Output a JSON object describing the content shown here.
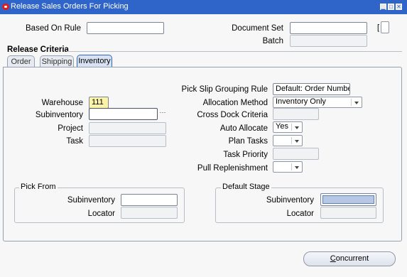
{
  "window": {
    "title": "Release Sales Orders For Picking"
  },
  "header": {
    "based_on_rule": {
      "label": "Based On Rule",
      "value": ""
    },
    "document_set": {
      "label": "Document Set",
      "value": ""
    },
    "batch": {
      "label": "Batch",
      "value": ""
    },
    "flex_field": "[ ]"
  },
  "release_criteria": {
    "title": "Release Criteria",
    "tabs": [
      {
        "label": "Order",
        "active": false
      },
      {
        "label": "Shipping",
        "active": false
      },
      {
        "label": "Inventory",
        "active": true
      }
    ]
  },
  "inventory": {
    "warehouse": {
      "label": "Warehouse",
      "value": "111"
    },
    "subinventory": {
      "label": "Subinventory",
      "value": ""
    },
    "project": {
      "label": "Project",
      "value": ""
    },
    "task": {
      "label": "Task",
      "value": ""
    },
    "pick_slip_grouping_rule": {
      "label": "Pick Slip Grouping Rule",
      "value": "Default: Order Number"
    },
    "allocation_method": {
      "label": "Allocation Method",
      "value": "Inventory Only"
    },
    "cross_dock_criteria": {
      "label": "Cross Dock Criteria",
      "value": ""
    },
    "auto_allocate": {
      "label": "Auto Allocate",
      "value": "Yes"
    },
    "plan_tasks": {
      "label": "Plan Tasks",
      "value": ""
    },
    "task_priority": {
      "label": "Task Priority",
      "value": ""
    },
    "pull_replenishment": {
      "label": "Pull Replenishment",
      "value": ""
    }
  },
  "pick_from": {
    "title": "Pick From",
    "subinventory": {
      "label": "Subinventory",
      "value": ""
    },
    "locator": {
      "label": "Locator",
      "value": ""
    }
  },
  "default_stage": {
    "title": "Default Stage",
    "subinventory": {
      "label": "Subinventory",
      "value": ""
    },
    "locator": {
      "label": "Locator",
      "value": ""
    }
  },
  "footer": {
    "concurrent_label": "Concurrent",
    "concurrent_mnemonic": "C",
    "concurrent_rest": "oncurrent"
  },
  "colors": {
    "titlebar": "#2f64c8",
    "focused_field": "#fbf3a8",
    "active_tab_border": "#2f64c8"
  }
}
